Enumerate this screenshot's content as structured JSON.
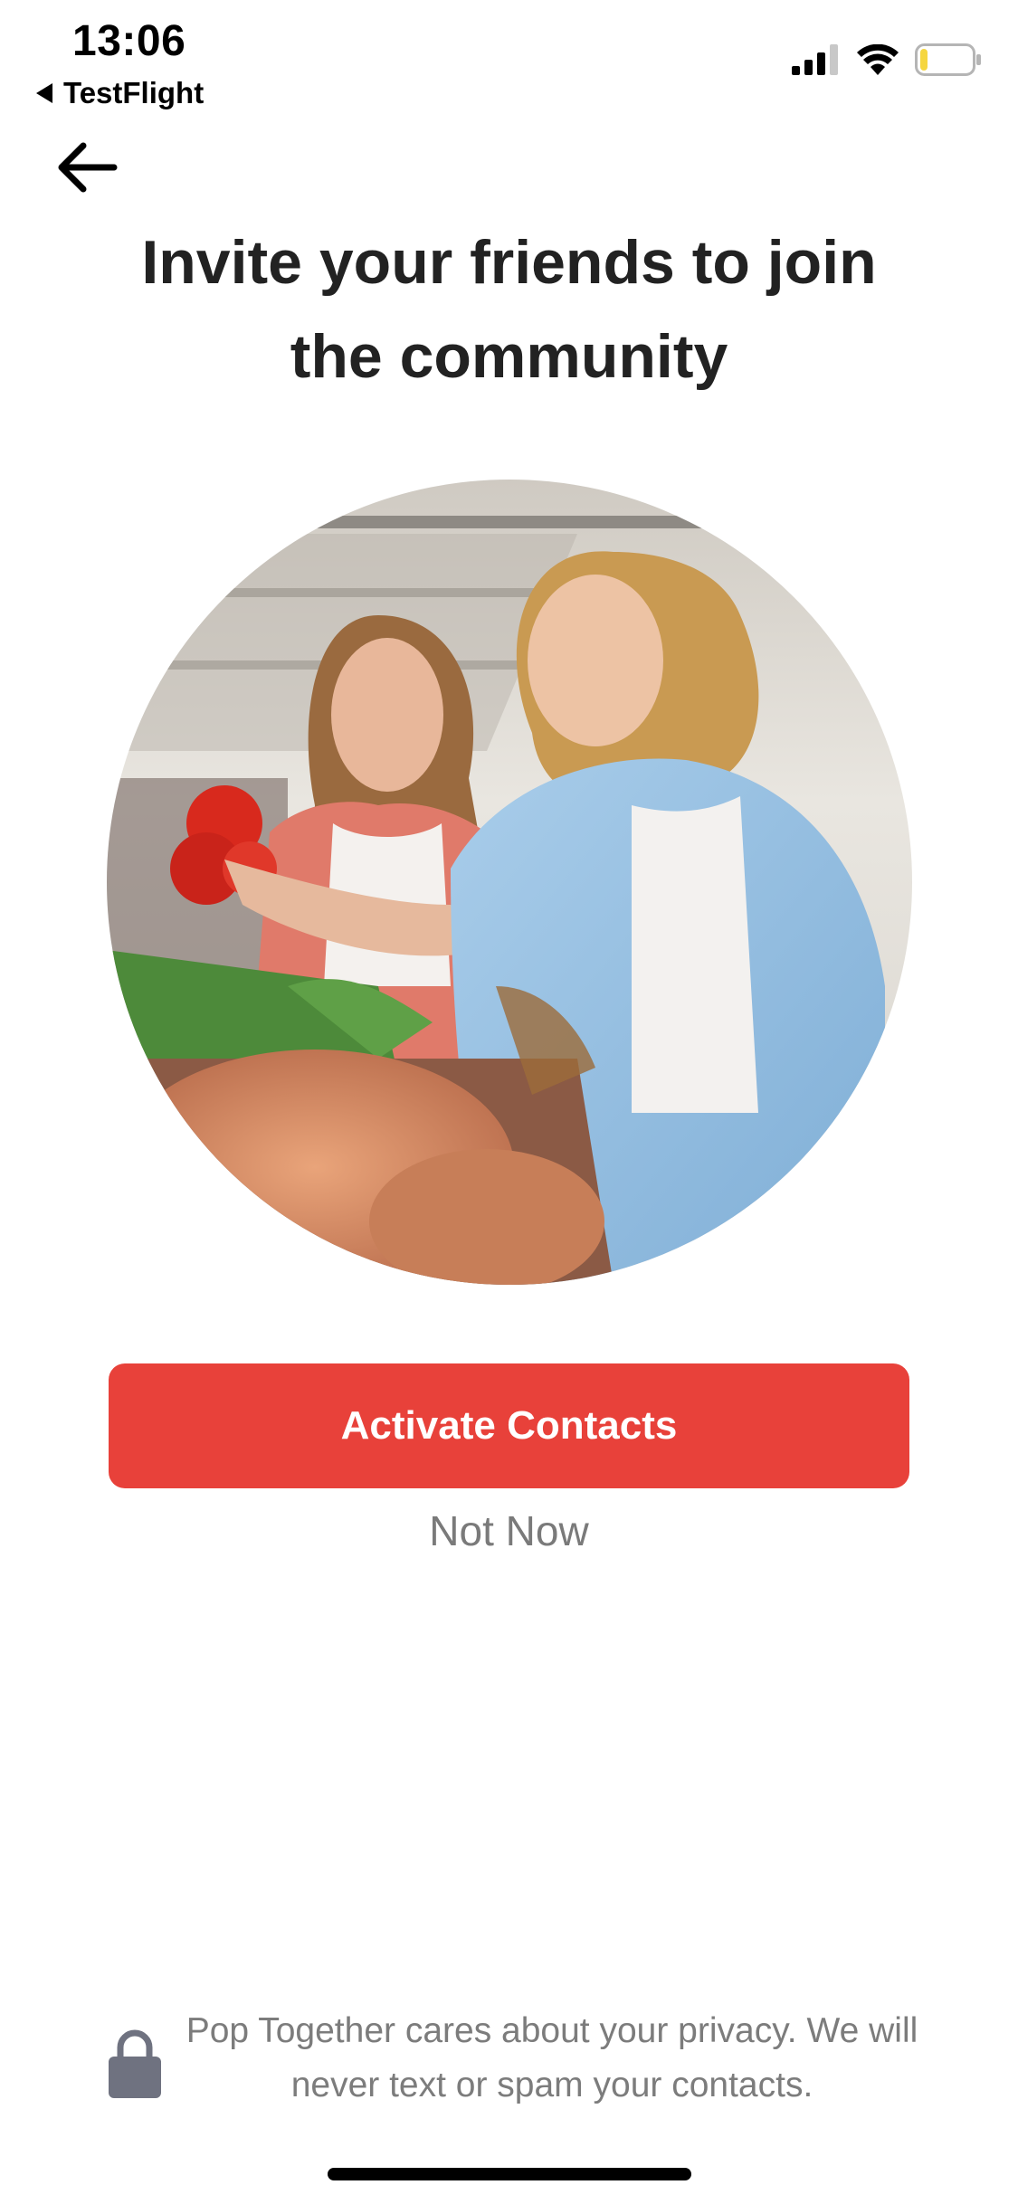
{
  "status_bar": {
    "time": "13:06",
    "back_app": "TestFlight",
    "icons": [
      "signal-icon",
      "wifi-icon",
      "battery-icon"
    ],
    "battery_level": 0.15,
    "battery_color": "#f5d640"
  },
  "nav": {
    "back_icon": "arrow-left-icon"
  },
  "header": {
    "title_line1": "Invite your friends to join",
    "title_line2": "the community"
  },
  "hero": {
    "icon": "market-photo"
  },
  "actions": {
    "primary_label": "Activate Contacts",
    "secondary_label": "Not Now",
    "accent_color": "#e8413a"
  },
  "privacy": {
    "icon": "lock-icon",
    "text": "Pop Together cares about your privacy.  We will never text or spam your contacts."
  }
}
